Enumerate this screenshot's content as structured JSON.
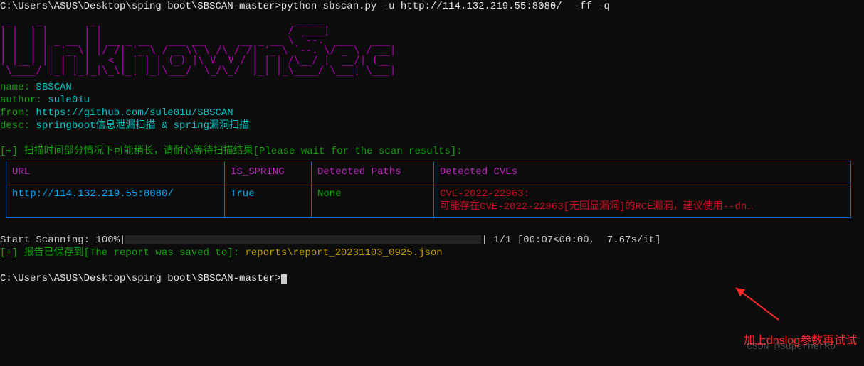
{
  "prompt1": "C:\\Users\\ASUS\\Desktop\\sping boot\\SBSCAN-master>",
  "command": "python sbscan.py -u http://114.132.219.55:8080/  -ff -q",
  "ascii_art": " _    _        _                                 _____            \n| |  | |      | |                               /  ___|           \n| |  | | _ __ | | __ _ __   ___ __      __ _ __ \\ `--.  ___   ___ \n| |  | || '_ \\| |/ /| '_ \\ / _ \\\\ \\ /\\ / /| '_ \\ `--. \\/ _ \\ / __|\n| |__| || | | |   < | | | | (_) |\\ V  V / | | | /\\__/ |  __/| (__ \n \\____/ |_| |_|_|\\_\\|_| |_|\\___/  \\_/\\_/  |_| |_\\____/ \\___| \\___|",
  "meta": {
    "name_label": "name:",
    "name_value": "SBSCAN",
    "author_label": "author:",
    "author_value": "sule01u",
    "from_label": "from:",
    "from_value": "https://github.com/sule01u/SBSCAN",
    "desc_label": "desc:",
    "desc_value": "springboot信息泄漏扫描 & spring漏洞扫描"
  },
  "wait_line": "[+] 扫描时间部分情况下可能稍长，请耐心等待扫描结果[Please wait for the scan results]:",
  "table": {
    "headers": [
      "URL",
      "IS_SPRING",
      "Detected Paths",
      "Detected CVEs"
    ],
    "row": {
      "url": "http://114.132.219.55:8080/",
      "is_spring": "True",
      "paths": "None",
      "cve_id": "CVE-2022-22963:",
      "cve_desc": "可能存在CVE-2022-22963[无回显漏洞]的RCE漏洞，建议使用--dn…"
    }
  },
  "progress": {
    "prefix": "Start Scanning: 100%",
    "suffix": " 1/1 [00:07<00:00,  7.67s/it]"
  },
  "saved_prefix": "[+] 报告已保存到[The report was saved to]:",
  "saved_path": "reports\\report_20231103_0925.json",
  "prompt2": "C:\\Users\\ASUS\\Desktop\\sping boot\\SBSCAN-master>",
  "watermark": "CSDN @SuperherRo",
  "annotation": "加上dnslog参数再试试"
}
